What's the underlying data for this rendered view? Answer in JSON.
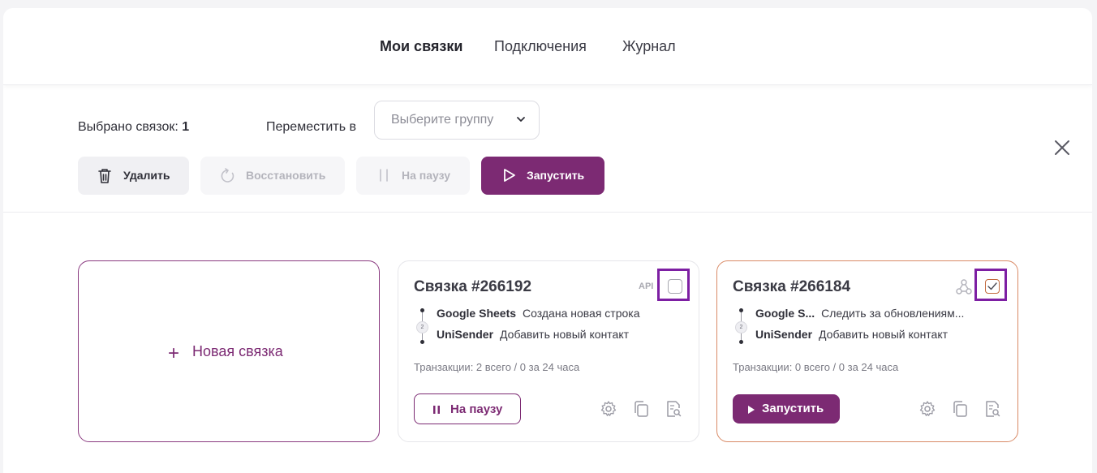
{
  "nav": {
    "tabs": [
      {
        "label": "Мои связки",
        "active": true
      },
      {
        "label": "Подключения",
        "active": false
      },
      {
        "label": "Журнал",
        "active": false
      }
    ]
  },
  "toolbar": {
    "selected_label": "Выбрано связок:",
    "selected_count": "1",
    "move_label": "Переместить в",
    "group_placeholder": "Выберите группу",
    "delete_label": "Удалить",
    "restore_label": "Восстановить",
    "pause_label": "На паузу",
    "run_label": "Запустить"
  },
  "new_card": {
    "plus": "+",
    "label": "Новая связка"
  },
  "cards": [
    {
      "title": "Связка #266192",
      "badge": "API",
      "checked": false,
      "steps": [
        {
          "num": "1",
          "app": "Google Sheets",
          "action": "Создана новая строка"
        },
        {
          "num": "2",
          "app": "UniSender",
          "action": "Добавить новый контакт"
        }
      ],
      "transactions": "Транзакции: 2 всего / 0 за 24 часа",
      "action_label": "На паузу"
    },
    {
      "title": "Связка #266184",
      "badge_icon": "webhook-icon",
      "checked": true,
      "steps": [
        {
          "num": "1",
          "app": "Google S...",
          "action": "Следить за обновлениям..."
        },
        {
          "num": "2",
          "app": "UniSender",
          "action": "Добавить новый контакт"
        }
      ],
      "transactions": "Транзакции: 0 всего / 0 за 24 часа",
      "action_label": "Запустить"
    }
  ],
  "colors": {
    "accent": "#7c2a73",
    "highlight": "#7d1fa3",
    "selected_card_border": "#d98a66"
  }
}
